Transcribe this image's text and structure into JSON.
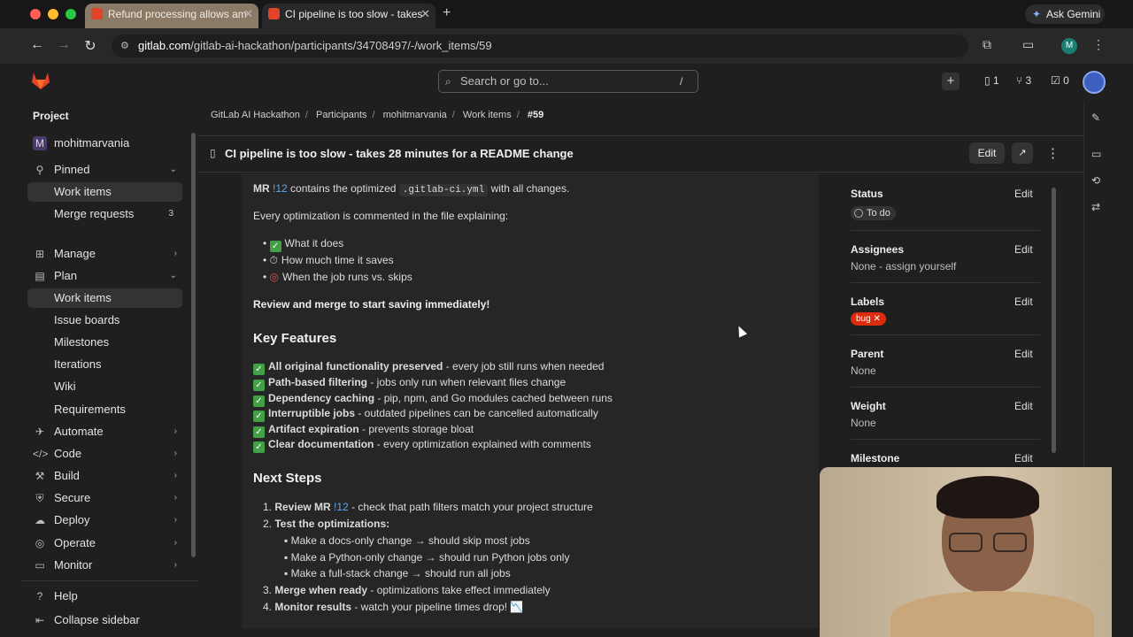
{
  "browser": {
    "tabs": [
      {
        "title": "Refund processing allows am"
      },
      {
        "title": "CI pipeline is too slow - takes"
      }
    ],
    "new_tab": "+",
    "gemini": "Ask Gemini",
    "url_domain": "gitlab.com",
    "url_path": "/gitlab-ai-hackathon/participants/34708497/-/work_items/59",
    "profile_initial": "M"
  },
  "header": {
    "search_placeholder": "Search or go to...",
    "search_shortcut": "/",
    "issues_count": "1",
    "mr_count": "3",
    "todo_count": "0"
  },
  "sidebar": {
    "section_title": "Project",
    "project_initial": "M",
    "project_name": "mohitmarvania",
    "pinned": "Pinned",
    "pinned_items": [
      {
        "label": "Work items"
      },
      {
        "label": "Merge requests",
        "count": "3"
      }
    ],
    "groups": [
      {
        "label": "Manage"
      },
      {
        "label": "Plan"
      }
    ],
    "plan_items": [
      "Work items",
      "Issue boards",
      "Milestones",
      "Iterations",
      "Wiki",
      "Requirements"
    ],
    "more": [
      "Automate",
      "Code",
      "Build",
      "Secure",
      "Deploy",
      "Operate",
      "Monitor"
    ],
    "help": "Help",
    "collapse": "Collapse sidebar"
  },
  "breadcrumb": [
    "GitLab AI Hackathon",
    "Participants",
    "mohitmarvania",
    "Work items",
    "#59"
  ],
  "title": "CI pipeline is too slow - takes 28 minutes for a README change",
  "edit_label": "Edit",
  "content": {
    "mr_prefix": "MR",
    "mr_link": "!12",
    "mr_mid": "contains the optimized",
    "mr_code": ".gitlab-ci.yml",
    "mr_suffix": "with all changes.",
    "every": "Every optimization is commented in the file explaining:",
    "bullets": [
      "What it does",
      "How much time it saves",
      "When the job runs vs. skips"
    ],
    "review": "Review and merge to start saving immediately!",
    "key_features_heading": "Key Features",
    "features": [
      {
        "bold": "All original functionality preserved",
        "rest": " - every job still runs when needed"
      },
      {
        "bold": "Path-based filtering",
        "rest": " - jobs only run when relevant files change"
      },
      {
        "bold": "Dependency caching",
        "rest": " - pip, npm, and Go modules cached between runs"
      },
      {
        "bold": "Interruptible jobs",
        "rest": " - outdated pipelines can be cancelled automatically"
      },
      {
        "bold": "Artifact expiration",
        "rest": " - prevents storage bloat"
      },
      {
        "bold": "Clear documentation",
        "rest": " - every optimization explained with comments"
      }
    ],
    "next_steps_heading": "Next Steps",
    "step1_bold": "Review MR",
    "step1_link": "!12",
    "step1_rest": " - check that path filters match your project structure",
    "step2_bold": "Test the optimizations:",
    "step2_sub": [
      "Make a docs-only change → should skip most jobs",
      "Make a Python-only change → should run Python jobs only",
      "Make a full-stack change → should run all jobs"
    ],
    "step3_bold": "Merge when ready",
    "step3_rest": " - optimizations take effect immediately",
    "step4_bold": "Monitor results",
    "step4_rest": " - watch your pipeline times drop! 📉"
  },
  "right_panel": {
    "status_label": "Status",
    "status_value": "To do",
    "assignees_label": "Assignees",
    "assignees_value": "None - assign yourself",
    "labels_label": "Labels",
    "label_bug": "bug",
    "parent_label": "Parent",
    "parent_value": "None",
    "weight_label": "Weight",
    "weight_value": "None",
    "milestone_label": "Milestone",
    "edit": "Edit"
  },
  "colors": {
    "accent_link": "#63a6e9",
    "bug_label": "#dd2b0e",
    "check": "#43a047"
  }
}
